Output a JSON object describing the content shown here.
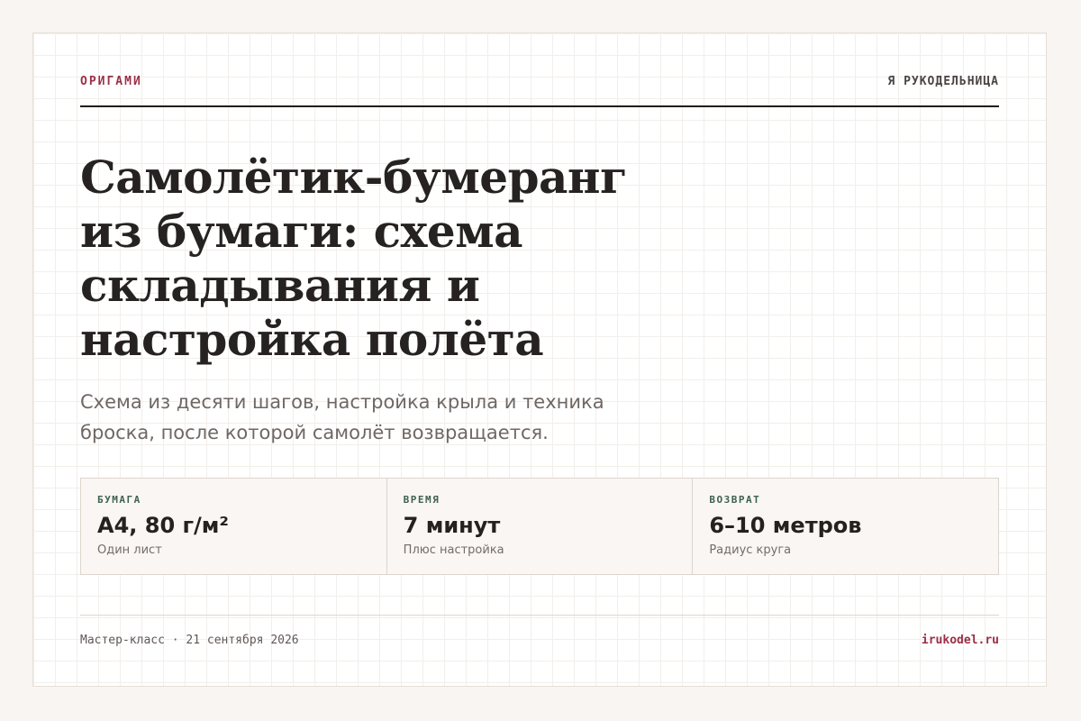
{
  "header": {
    "kicker": "ОРИГАМИ",
    "brand": "Я РУКОДЕЛЬНИЦА"
  },
  "article": {
    "title": "Самолётик-бумеранг из бумаги: схема складывания и настройка полёта",
    "subtitle": "Схема из десяти шагов, настройка крыла и техника броска, после которой самолёт возвращается."
  },
  "stats": [
    {
      "label": "БУМАГА",
      "value": "A4, 80 г/м²",
      "note": "Один лист"
    },
    {
      "label": "ВРЕМЯ",
      "value": "7 минут",
      "note": "Плюс настройка"
    },
    {
      "label": "ВОЗВРАТ",
      "value": "6–10 метров",
      "note": "Радиус круга"
    }
  ],
  "footer": {
    "event": "Мастер-класс · 21 сентября 2026",
    "site": "irukodel.ru"
  },
  "colors": {
    "accent": "#9a3047",
    "label_green": "#3f6150",
    "text_dark": "#252221",
    "background": "#f8f5f2"
  }
}
